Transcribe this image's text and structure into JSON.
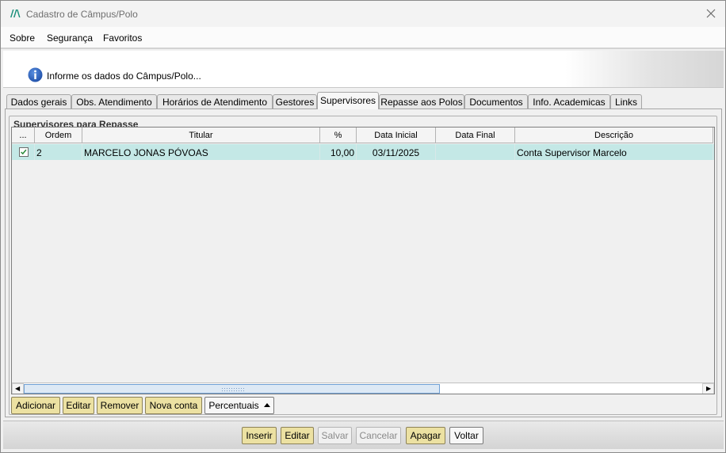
{
  "window": {
    "title": "Cadastro de Câmpus/Polo",
    "close_glyph": "✕"
  },
  "menu": {
    "items": [
      {
        "label": "Sobre"
      },
      {
        "label": "Segurança"
      },
      {
        "label": "Favoritos"
      }
    ]
  },
  "info": {
    "icon": "info-icon",
    "text": "Informe os dados do Câmpus/Polo..."
  },
  "tabs": [
    {
      "label": "Dados gerais"
    },
    {
      "label": "Obs. Atendimento"
    },
    {
      "label": "Horários de Atendimento"
    },
    {
      "label": "Gestores"
    },
    {
      "label": "Supervisores",
      "active": true
    },
    {
      "label": "Repasse aos Polos"
    },
    {
      "label": "Documentos"
    },
    {
      "label": "Info. Academicas"
    },
    {
      "label": "Links"
    }
  ],
  "group": {
    "title": "Supervisores para Repasse"
  },
  "grid": {
    "columns": [
      "...",
      "Ordem",
      "Titular",
      "%",
      "Data Inicial",
      "Data Final",
      "Descrição"
    ],
    "rows": [
      {
        "checked": true,
        "ordem": "2",
        "titular": "MARCELO JONAS PÓVOAS",
        "percent": "10,00",
        "data_inicial": "03/11/2025",
        "data_final": "",
        "descricao": "Conta Supervisor Marcelo"
      }
    ],
    "scroll_left": "◀",
    "scroll_right": "▶"
  },
  "grid_actions": {
    "adicionar": "Adicionar",
    "editar": "Editar",
    "remover": "Remover",
    "nova_conta": "Nova conta",
    "percentuais": "Percentuais"
  },
  "footer_actions": {
    "inserir": "Inserir",
    "editar": "Editar",
    "salvar": "Salvar",
    "cancelar": "Cancelar",
    "apagar": "Apagar",
    "voltar": "Voltar"
  },
  "colors": {
    "selected_row": "#c4e8e6",
    "gold_button": "#ece1a2",
    "accent_logo": "#1a8f7a"
  }
}
